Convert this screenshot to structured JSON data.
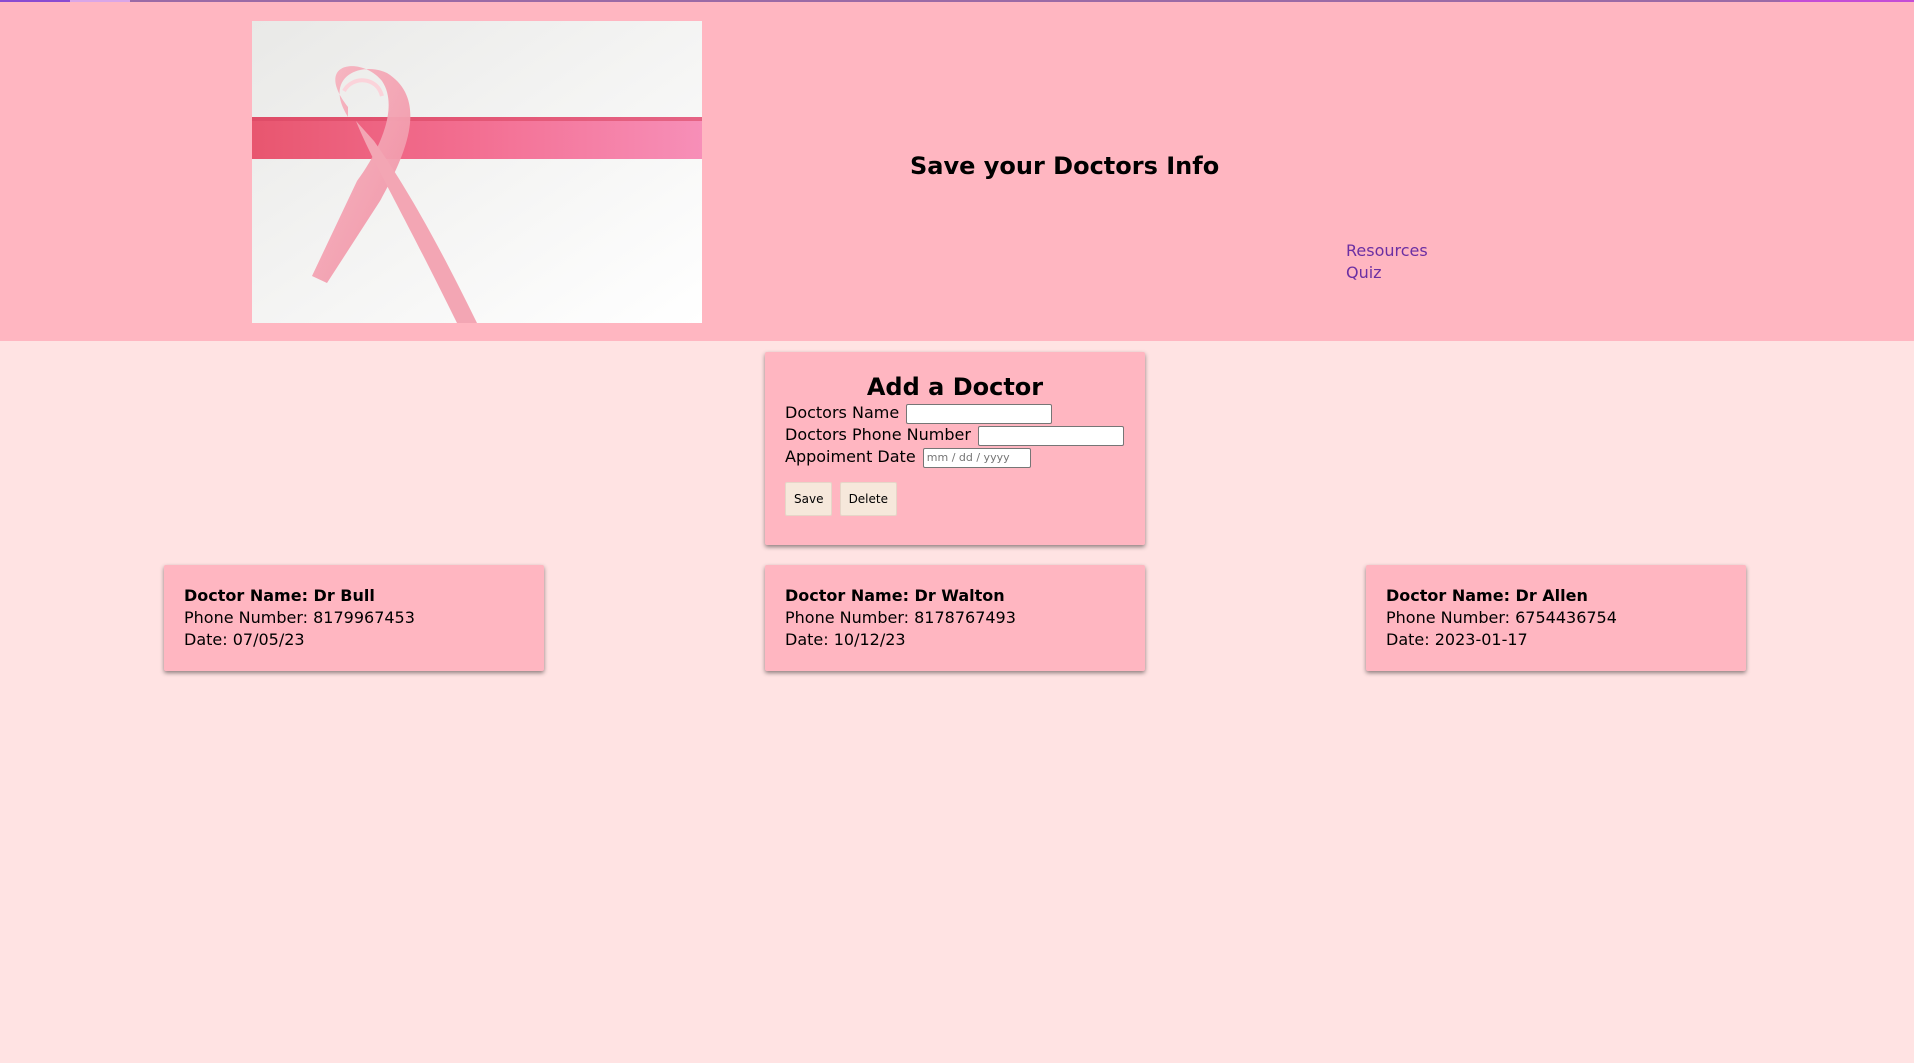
{
  "header": {
    "title": "Save your Doctors Info",
    "nav": [
      {
        "label": "Resources"
      },
      {
        "label": "Quiz"
      }
    ],
    "hero_image_alt": "pink-ribbon"
  },
  "form": {
    "title": "Add a Doctor",
    "name_label": "Doctors Name",
    "name_value": "",
    "phone_label": "Doctors Phone Number",
    "phone_value": "",
    "date_label": "Appoiment Date",
    "date_placeholder": "mm / dd / yyyy",
    "save_label": "Save",
    "delete_label": "Delete"
  },
  "doctors": [
    {
      "name": "Doctor Name: Dr Bull",
      "phone": "Phone Number: 8179967453",
      "date": "Date: 07/05/23"
    },
    {
      "name": "Doctor Name: Dr Walton",
      "phone": "Phone Number: 8178767493",
      "date": "Date: 10/12/23"
    },
    {
      "name": "Doctor Name: Dr Allen",
      "phone": "Phone Number: 6754436754",
      "date": "Date: 2023-01-17"
    }
  ],
  "colors": {
    "header_bg": "#ffb6c1",
    "page_bg": "#ffe3e3",
    "link": "#6b2fa3",
    "button_bg": "#f6e8db"
  }
}
